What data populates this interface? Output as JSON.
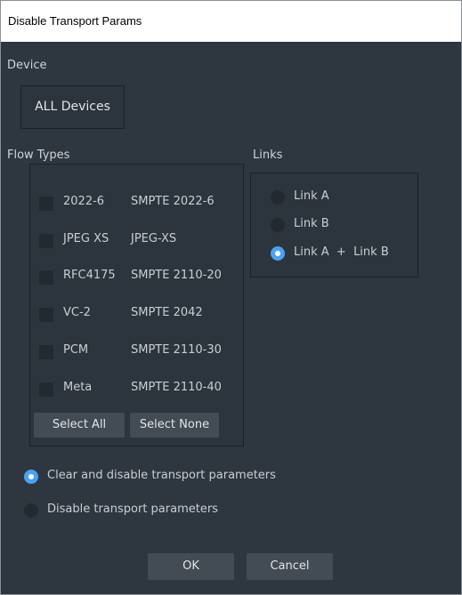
{
  "window": {
    "title": "Disable Transport Params"
  },
  "device": {
    "label": "Device",
    "value": "ALL Devices"
  },
  "flow_types": {
    "label": "Flow Types",
    "items": [
      {
        "code": "2022-6",
        "name": "SMPTE 2022-6",
        "checked": false
      },
      {
        "code": "JPEG XS",
        "name": "JPEG-XS",
        "checked": false
      },
      {
        "code": "RFC4175",
        "name": "SMPTE 2110-20",
        "checked": false
      },
      {
        "code": "VC-2",
        "name": "SMPTE 2042",
        "checked": false
      },
      {
        "code": "PCM",
        "name": "SMPTE 2110-30",
        "checked": false
      },
      {
        "code": "Meta",
        "name": "SMPTE 2110-40",
        "checked": false
      }
    ],
    "select_all_label": "Select All",
    "select_none_label": "Select None"
  },
  "links": {
    "label": "Links",
    "options": [
      {
        "label": "Link A",
        "checked": false
      },
      {
        "label": "Link B",
        "checked": false
      },
      {
        "label": "Link A  +  Link B",
        "checked": true
      }
    ]
  },
  "mode": {
    "options": [
      {
        "label": "Clear and disable transport parameters",
        "checked": true
      },
      {
        "label": "Disable transport parameters",
        "checked": false
      }
    ]
  },
  "footer": {
    "ok_label": "OK",
    "cancel_label": "Cancel"
  },
  "colors": {
    "dialog_bg": "#2e3640",
    "accent": "#4aa3f0",
    "button_bg": "#434b55"
  }
}
